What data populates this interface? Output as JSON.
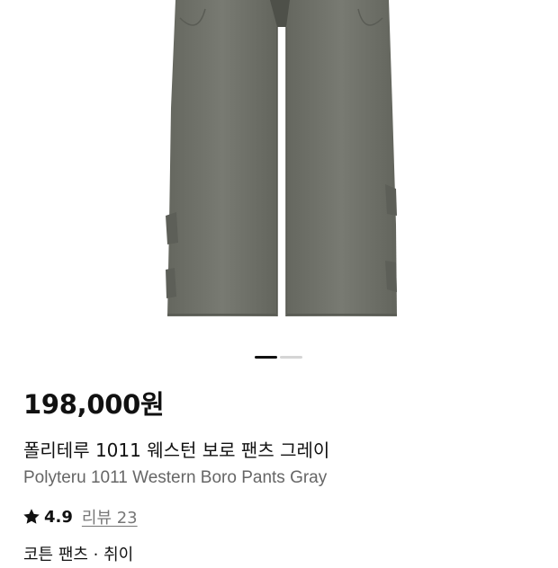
{
  "product": {
    "price": "198,000원",
    "name_ko": "폴리테루 1011 웨스턴 보로 팬츠 그레이",
    "name_en": "Polyteru 1011 Western Boro Pants Gray",
    "rating": "4.9",
    "reviews_label": "리뷰 23",
    "category_partial": "코튼 팬츠 · 취이"
  },
  "gallery": {
    "image_alt": "gray western boro pants",
    "current_page": 1,
    "total_pages": 2
  },
  "colors": {
    "pants": "#6e7068",
    "text_primary": "#111111",
    "text_secondary": "#666666",
    "pager_active": "#111111",
    "pager_inactive": "#d5d5d5"
  }
}
